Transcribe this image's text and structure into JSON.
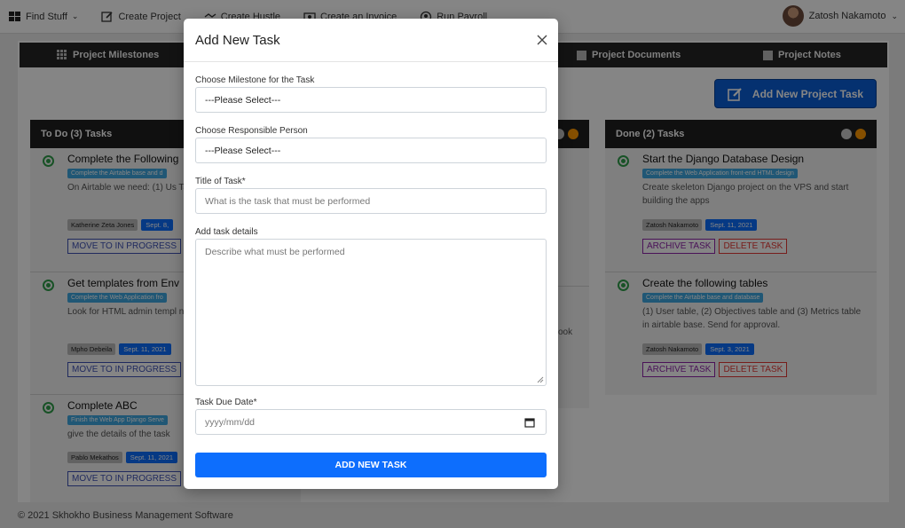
{
  "topnav": {
    "items": [
      {
        "label": "Find Stuff",
        "icon": "grid-icon"
      },
      {
        "label": "Create Project",
        "icon": "edit-icon"
      },
      {
        "label": "Create Hustle",
        "icon": "handshake-icon"
      },
      {
        "label": "Create an Invoice",
        "icon": "invoice-icon"
      },
      {
        "label": "Run Payroll",
        "icon": "payroll-icon"
      }
    ],
    "user_name": "Zatosh Nakamoto"
  },
  "tabs": [
    {
      "label": "Project Milestones",
      "icon": "grid-icon"
    },
    {
      "label": "Project Documents",
      "icon": "folder-icon"
    },
    {
      "label": "Project Notes",
      "icon": "note-icon"
    }
  ],
  "add_project_task_label": "Add New Project Task",
  "todo": {
    "header": "To Do (3) Tasks",
    "cards": [
      {
        "title": "Complete the Following",
        "milestone": "Complete the Airtable base and d",
        "desc": "On Airtable we need: (1) Us Table and (3) Metrics table",
        "person": "Katherine Zeta Jones",
        "date": "Sept. 8,",
        "move": "MOVE TO IN PROGRESS"
      },
      {
        "title": "Get templates from Env",
        "milestone": "Complete the Web Application fro",
        "desc": "Look for HTML admin templ need to complete the fron e",
        "person": "Mpho Debeila",
        "date": "Sept. 11, 2021",
        "move": "MOVE TO IN PROGRESS"
      },
      {
        "title": "Complete ABC",
        "milestone": "Finish the Web App Django Serve",
        "desc": "give the details of the task",
        "person": "Pablo Mekathos",
        "date": "Sept. 11, 2021",
        "move": "MOVE TO IN PROGRESS"
      }
    ]
  },
  "inprogress": {
    "visible_text": "ook"
  },
  "done": {
    "header": "Done (2) Tasks",
    "cards": [
      {
        "title": "Start the Django Database Design",
        "milestone": "Complete the Web Application front-end HTML design",
        "desc": "Create skeleton Django project on the VPS and start building the apps",
        "person": "Zatosh Nakamoto",
        "date": "Sept. 11, 2021",
        "archive": "ARCHIVE TASK",
        "delete": "DELETE TASK"
      },
      {
        "title": "Create the following tables",
        "milestone": "Complete the Airtable base and database",
        "desc": "(1) User table, (2) Objectives table and (3) Metrics table in airtable base. Send for approval.",
        "person": "Zatosh Nakamoto",
        "date": "Sept. 3, 2021",
        "archive": "ARCHIVE TASK",
        "delete": "DELETE TASK"
      }
    ]
  },
  "footer": "© 2021 Skhokho Business Management Software",
  "modal": {
    "title": "Add New Task",
    "milestone_label": "Choose Milestone for the Task",
    "milestone_value": "---Please Select---",
    "person_label": "Choose Responsible Person",
    "person_value": "---Please Select---",
    "title_label": "Title of Task*",
    "title_placeholder": "What is the task that must be performed",
    "details_label": "Add task details",
    "details_placeholder": "Describe what must be performed",
    "due_label": "Task Due Date*",
    "due_placeholder": "yyyy/mm/dd",
    "submit_label": "ADD NEW TASK"
  },
  "colors": {
    "primary": "#0d6efd",
    "dark": "#1f1f1f",
    "success": "#2e9e4a",
    "warning": "#ff9800"
  }
}
